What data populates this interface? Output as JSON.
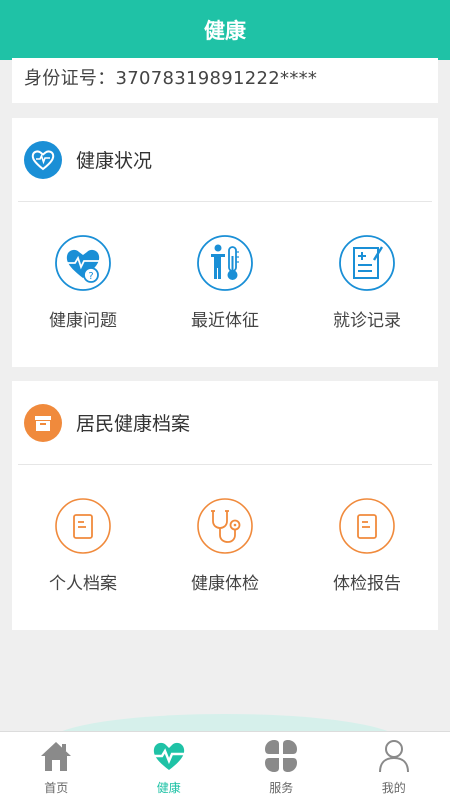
{
  "header": {
    "title": "健康"
  },
  "id_card": {
    "text": "身份证号：37078319891222****"
  },
  "health_status": {
    "title": "健康状况",
    "items": [
      {
        "label": "健康问题",
        "icon": "heart-question-icon"
      },
      {
        "label": "最近体征",
        "icon": "person-thermometer-icon"
      },
      {
        "label": "就诊记录",
        "icon": "clipboard-plus-icon"
      }
    ]
  },
  "health_archive": {
    "title": "居民健康档案",
    "items": [
      {
        "label": "个人档案",
        "icon": "document-icon"
      },
      {
        "label": "健康体检",
        "icon": "stethoscope-icon"
      },
      {
        "label": "体检报告",
        "icon": "report-icon"
      }
    ]
  },
  "tabbar": {
    "tabs": [
      {
        "label": "首页",
        "icon": "home-icon"
      },
      {
        "label": "健康",
        "icon": "heartbeat-icon",
        "active": true
      },
      {
        "label": "服务",
        "icon": "grid-icon"
      },
      {
        "label": "我的",
        "icon": "user-icon"
      }
    ]
  },
  "colors": {
    "brand": "#1fc2a6",
    "blue": "#1a8fd6",
    "orange": "#f08a3c"
  }
}
